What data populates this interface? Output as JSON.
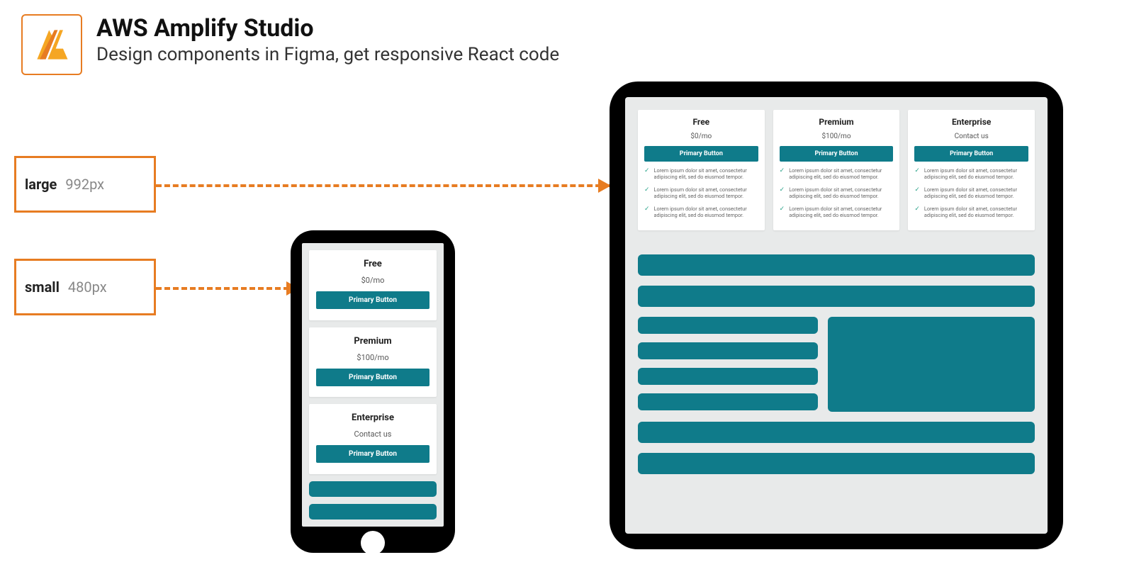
{
  "header": {
    "title": "AWS Amplify Studio",
    "subtitle": "Design components in Figma, get responsive React code"
  },
  "breakpoints": {
    "large": {
      "label": "large",
      "value": "992px"
    },
    "small": {
      "label": "small",
      "value": "480px"
    }
  },
  "pricing": {
    "plans": [
      {
        "name": "Free",
        "price": "$0/mo",
        "cta": "Primary Button"
      },
      {
        "name": "Premium",
        "price": "$100/mo",
        "cta": "Primary Button"
      },
      {
        "name": "Enterprise",
        "price": "Contact us",
        "cta": "Primary Button"
      }
    ],
    "feature_text": "Lorem ipsum dolor sit amet, consectetur adipiscing elit, sed do eiusmod tempor."
  },
  "colors": {
    "accent": "#e77c22",
    "teal": "#0f7b8a"
  }
}
